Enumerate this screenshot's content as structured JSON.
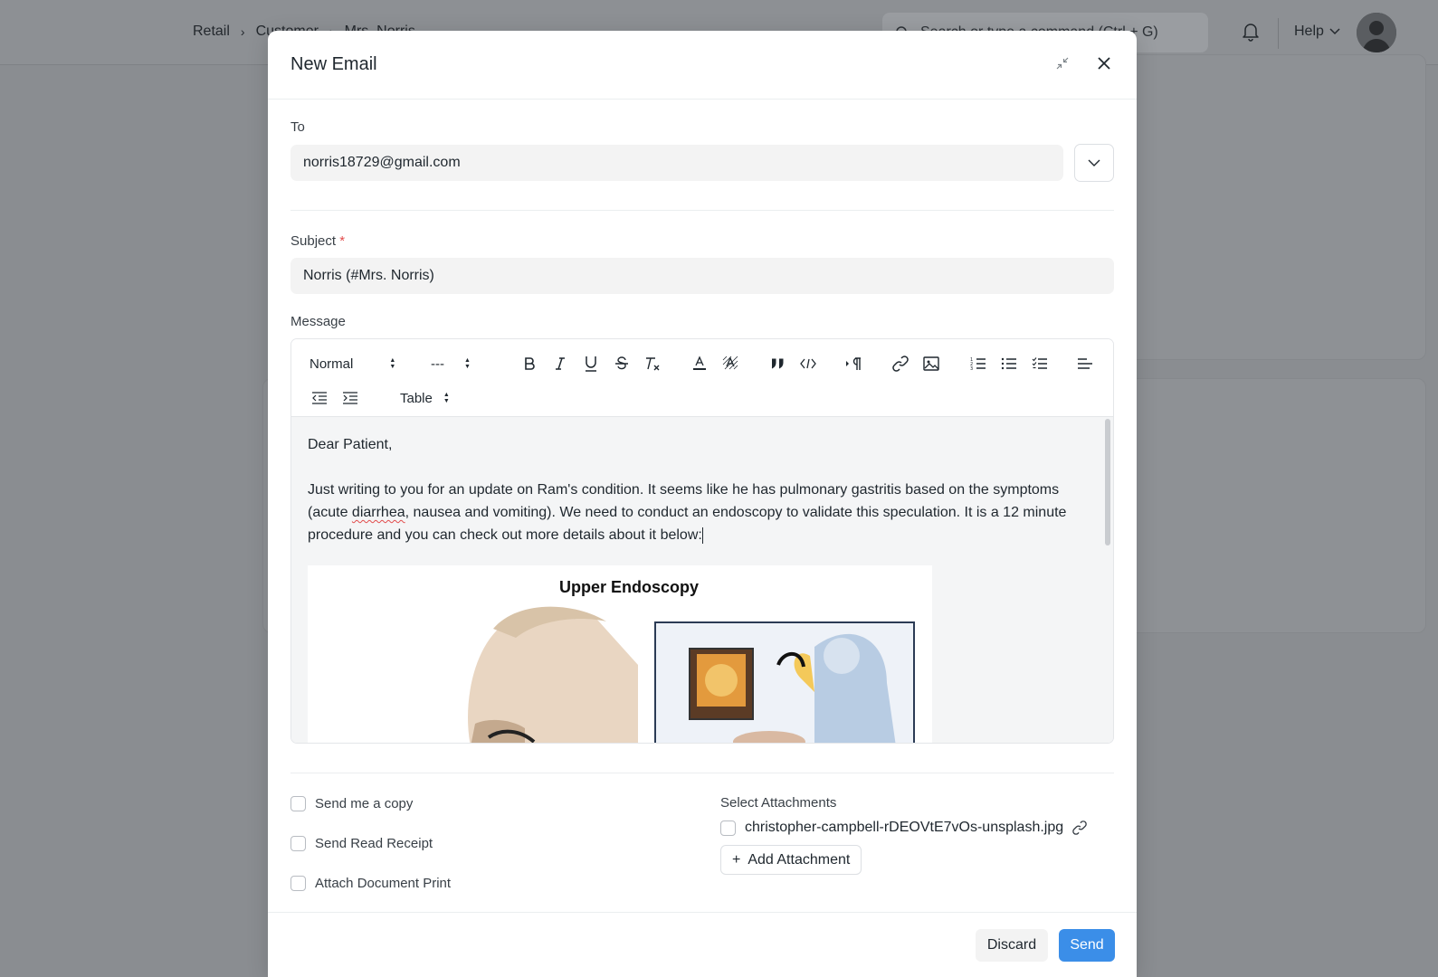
{
  "background": {
    "breadcrumbs": [
      "Retail",
      "Customer",
      "Mrs. Norris"
    ],
    "search_placeholder": "Search or type a command (Ctrl + G)",
    "help_label": "Help"
  },
  "modal": {
    "title": "New Email",
    "to": {
      "label": "To",
      "value": "norris18729@gmail.com"
    },
    "subject": {
      "label": "Subject",
      "required_mark": "*",
      "value": "Norris (#Mrs. Norris)"
    },
    "message": {
      "label": "Message",
      "toolbar": {
        "heading_select": "Normal",
        "size_select": "---",
        "table_select": "Table"
      },
      "greeting": "Dear Patient,",
      "body_before": "Just writing to you for an update on Ram's condition. It seems like he has pulmonary gastritis based on the symptoms (acute ",
      "misspelled": "diarrhea",
      "body_after": ", nausea and vomiting). We need to conduct an endoscopy to validate this speculation. It is a 12 minute procedure and you can check out more details about it below:",
      "figure_title": "Upper Endoscopy"
    },
    "options": [
      {
        "label": "Send me a copy"
      },
      {
        "label": "Send Read Receipt"
      },
      {
        "label": "Attach Document Print"
      }
    ],
    "attachments": {
      "label": "Select Attachments",
      "files": [
        "christopher-campbell-rDEOVtE7vOs-unsplash.jpg"
      ],
      "add_label": "Add Attachment"
    },
    "buttons": {
      "discard": "Discard",
      "send": "Send"
    }
  },
  "colors": {
    "primary": "#3b8ee8",
    "required": "#e24c4c",
    "overlay": "#8a8d91"
  }
}
